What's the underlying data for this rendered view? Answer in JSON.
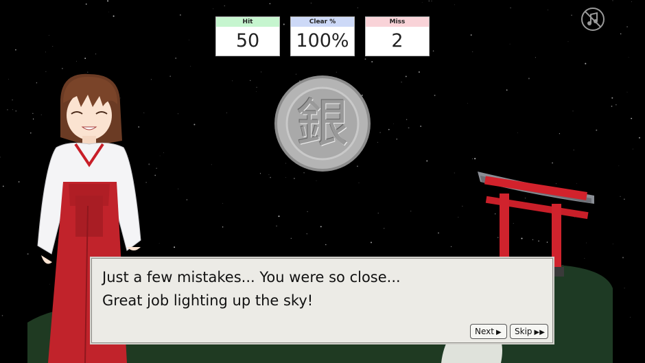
{
  "stats": {
    "hit": {
      "label": "Hit",
      "value": "50"
    },
    "clear": {
      "label": "Clear %",
      "value": "100%"
    },
    "miss": {
      "label": "Miss",
      "value": "2"
    }
  },
  "medal": {
    "kanji": "銀"
  },
  "dialog": {
    "line1": "Just a few mistakes... You were so close...",
    "line2": "Great job lighting up the sky!",
    "next_label": "Next",
    "skip_label": "Skip"
  },
  "icons": {
    "mute": "music-muted-icon",
    "next": "play-triangle-icon",
    "skip": "fast-forward-icon"
  }
}
